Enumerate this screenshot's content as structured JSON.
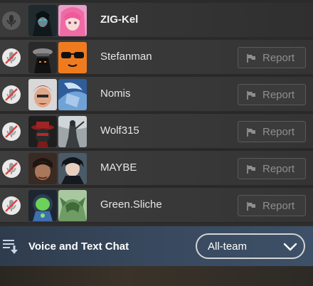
{
  "players": [
    {
      "name": "ZIG-Kel",
      "self": true,
      "muted": false,
      "report": null
    },
    {
      "name": "Stefanman",
      "self": false,
      "muted": true,
      "report": "Report"
    },
    {
      "name": "Nomis",
      "self": false,
      "muted": true,
      "report": "Report"
    },
    {
      "name": "Wolf315",
      "self": false,
      "muted": true,
      "report": "Report"
    },
    {
      "name": "MAYBE",
      "self": false,
      "muted": true,
      "report": "Report"
    },
    {
      "name": "Green.Sliche",
      "self": false,
      "muted": true,
      "report": "Report"
    }
  ],
  "footer": {
    "label": "Voice and Text Chat",
    "channel": "All-team"
  },
  "colors": {
    "mute_slash": "#e04040",
    "footer_blue": "#394a60"
  },
  "icons": [
    "microphone-icon",
    "microphone-muted-icon",
    "flag-icon",
    "chat-settings-icon",
    "chevron-down-icon"
  ]
}
